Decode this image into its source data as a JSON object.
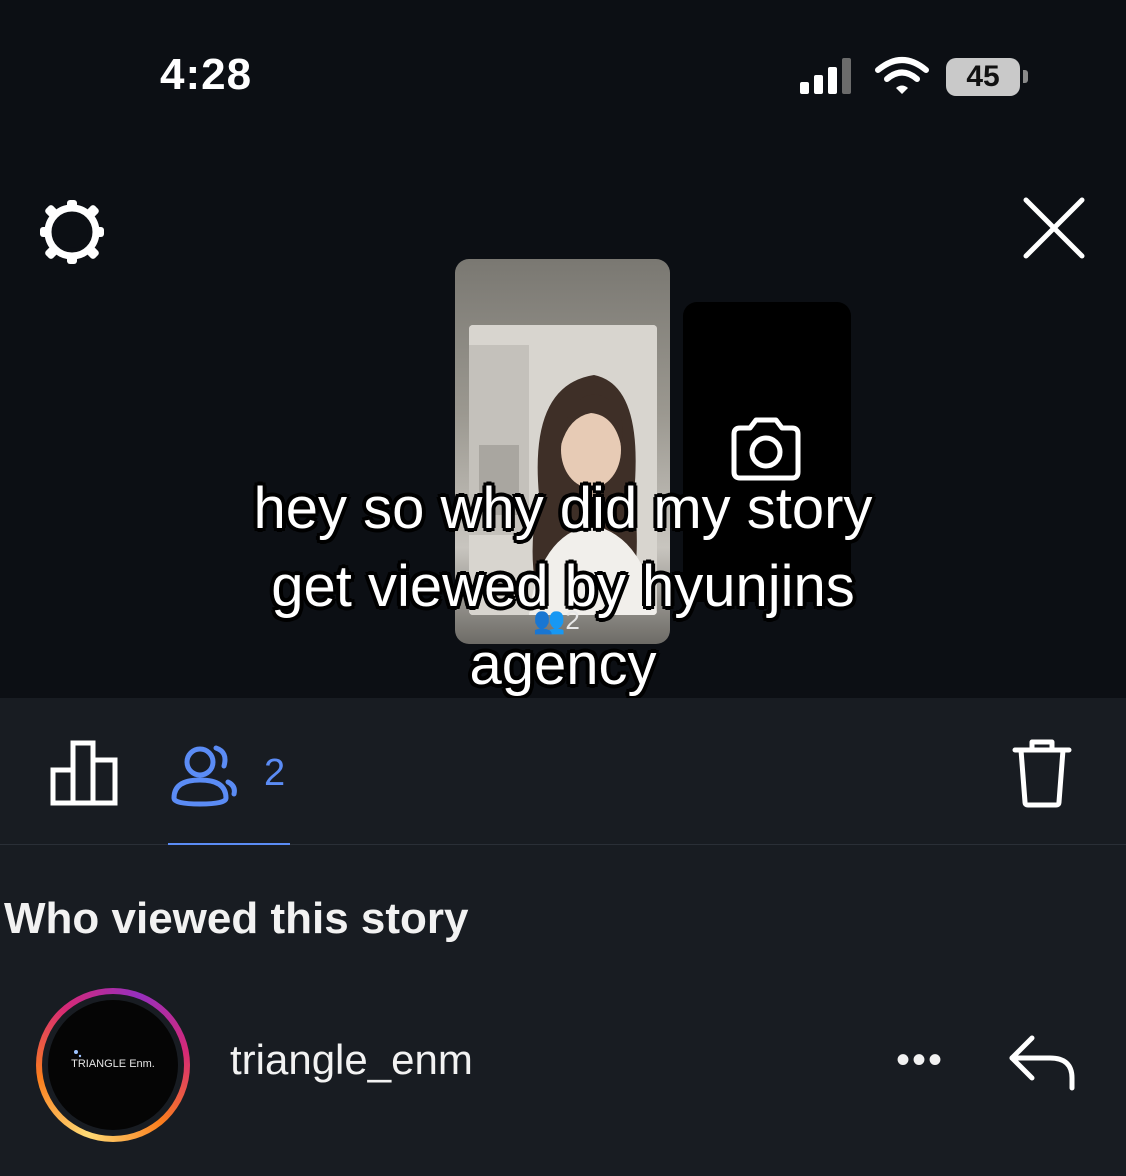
{
  "status_bar": {
    "time": "4:28",
    "battery": "45"
  },
  "story": {
    "views_overlay": "2"
  },
  "caption": {
    "lines": [
      "hey so why did my story",
      "get viewed by hyunjins",
      "agency"
    ]
  },
  "tabs": {
    "viewers_count": "2"
  },
  "section": {
    "title": "Who viewed this story"
  },
  "viewers": [
    {
      "username": "triangle_enm",
      "avatar_text": "TRIANGLE Enm."
    }
  ],
  "more_label": "•••",
  "colors": {
    "accent": "#5b8cf5",
    "background": "#0c0f14",
    "panel": "#181c22"
  },
  "icons": [
    "gear-icon",
    "close-icon",
    "camera-icon",
    "insights-icon",
    "viewers-icon",
    "trash-icon",
    "reply-icon"
  ]
}
